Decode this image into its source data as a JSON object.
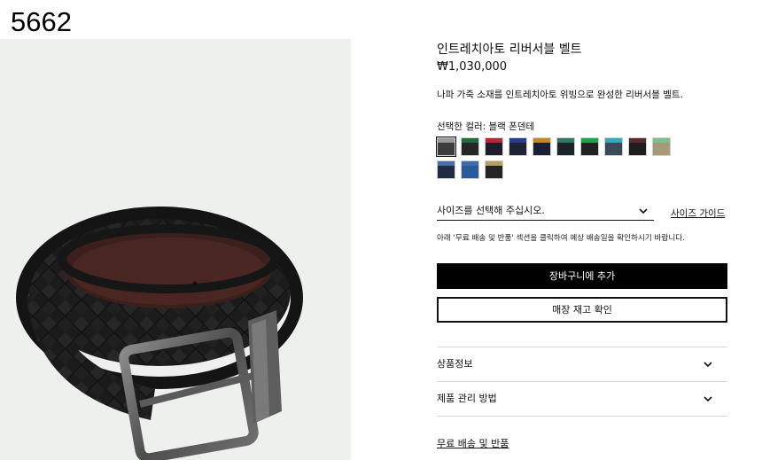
{
  "page_id": "5662",
  "product": {
    "title": "인트레치아토 리버서블 벨트",
    "price": "₩1,030,000",
    "description": "나파 가죽 소재를 인트레치아토 위빙으로 완성한 리버서블 벨트."
  },
  "color": {
    "label": "선택한 컬러: 블랙 폰덴테",
    "swatches": [
      {
        "top": "#9a9a9a",
        "base": "#3c3c3c"
      },
      {
        "top": "#1f6d3b",
        "base": "#262626"
      },
      {
        "top": "#b02a36",
        "base": "#1c1c2a"
      },
      {
        "top": "#2a3f8c",
        "base": "#1d2236"
      },
      {
        "top": "#c8862a",
        "base": "#1b1f33"
      },
      {
        "top": "#2d7a6a",
        "base": "#1c2428"
      },
      {
        "top": "#25a04a",
        "base": "#222"
      },
      {
        "top": "#3aa7b8",
        "base": "#3b4a5a"
      },
      {
        "top": "#5a2a2a",
        "base": "#1d1d1d"
      },
      {
        "top": "#7bbf8a",
        "base": "#a79a78"
      },
      {
        "top": "#4a6fa8",
        "base": "#1f2b40"
      },
      {
        "top": "#3d6db0",
        "base": "#2a5a9a"
      },
      {
        "top": "#b7a060",
        "base": "#252525"
      }
    ]
  },
  "size": {
    "placeholder": "사이즈를 선택해 주십시오.",
    "guide_label": "사이즈 가이드"
  },
  "notice": "아래 '무료 배송 및 반품' 섹션을 클릭하여 예상 배송일을 확인하시기 바랍니다.",
  "actions": {
    "add_to_cart": "장바구니에 추가",
    "check_store": "매장 재고 확인"
  },
  "accordions": [
    {
      "label": "상품정보"
    },
    {
      "label": "제품 관리 방법"
    }
  ],
  "shipping_link": "무료 배송 및 반품"
}
